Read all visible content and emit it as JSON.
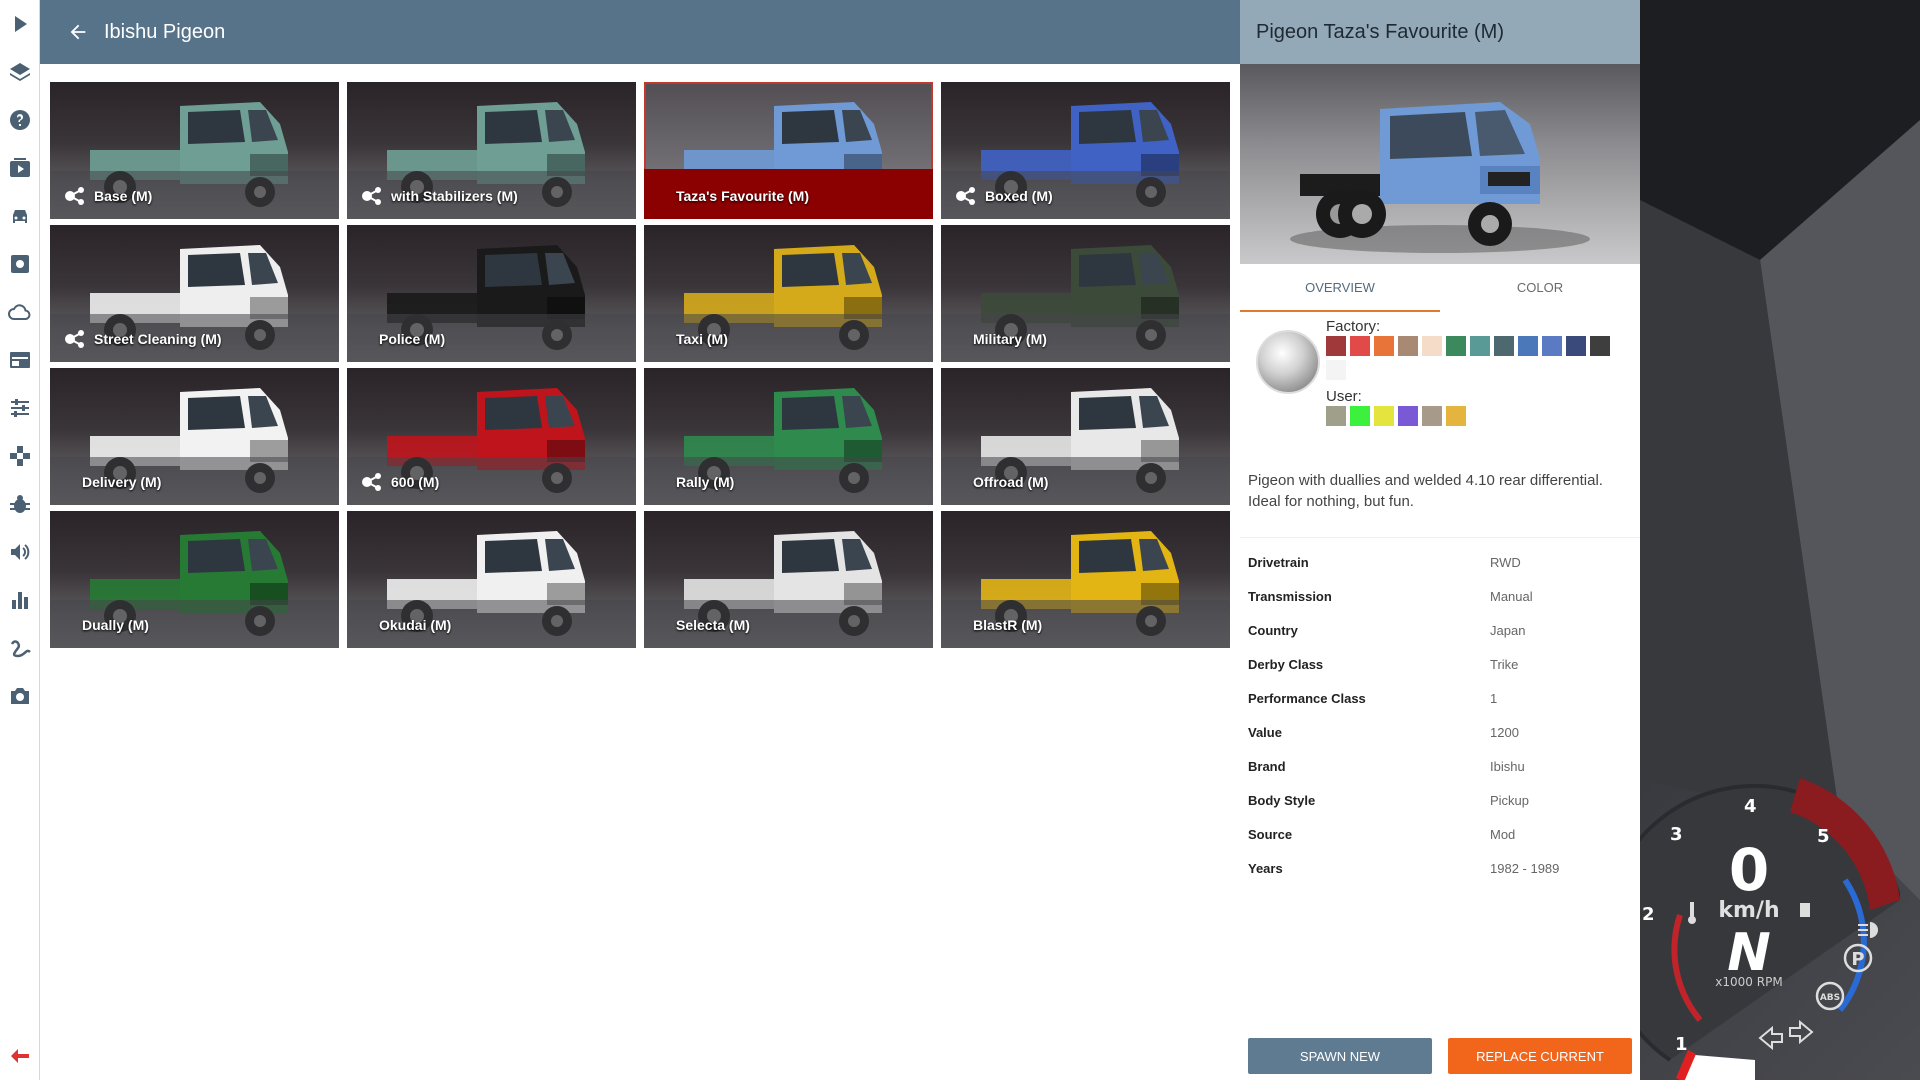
{
  "sidebar": {
    "icons": [
      "play-icon",
      "layers-icon",
      "help-icon",
      "media-icon",
      "car-icon",
      "settings-icon",
      "cloud-icon",
      "dashboard-icon",
      "sliders-icon",
      "gamepad-icon",
      "bug-icon",
      "audio-icon",
      "stats-icon",
      "path-icon",
      "camera-icon"
    ],
    "back_icon": "exit-arrow-icon"
  },
  "main": {
    "title": "Ibishu Pigeon",
    "tiles": [
      {
        "label": "Base (M)",
        "has_config_icon": true,
        "color": "#6e9e94"
      },
      {
        "label": "with Stabilizers (M)",
        "has_config_icon": true,
        "color": "#6e9e94"
      },
      {
        "label": "Taza's Favourite (M)",
        "has_config_icon": false,
        "color": "#6f9ad6",
        "selected": true
      },
      {
        "label": "Boxed (M)",
        "has_config_icon": true,
        "color": "#3f62c4"
      },
      {
        "label": "Street Cleaning (M)",
        "has_config_icon": true,
        "color": "#eeeeee"
      },
      {
        "label": "Police (M)",
        "has_config_icon": false,
        "color": "#1a1a1a"
      },
      {
        "label": "Taxi (M)",
        "has_config_icon": false,
        "color": "#d4aa1a"
      },
      {
        "label": "Military (M)",
        "has_config_icon": false,
        "color": "#3c4a3a"
      },
      {
        "label": "Delivery (M)",
        "has_config_icon": false,
        "color": "#f2f2f2"
      },
      {
        "label": "600 (M)",
        "has_config_icon": true,
        "color": "#c0141c"
      },
      {
        "label": "Rally (M)",
        "has_config_icon": false,
        "color": "#2f8a4e"
      },
      {
        "label": "Offroad (M)",
        "has_config_icon": false,
        "color": "#e8e8e8"
      },
      {
        "label": "Dually (M)",
        "has_config_icon": false,
        "color": "#267a34"
      },
      {
        "label": "Okudai (M)",
        "has_config_icon": false,
        "color": "#f0f0f0"
      },
      {
        "label": "Selecta (M)",
        "has_config_icon": false,
        "color": "#e4e4e4"
      },
      {
        "label": "BlastR (M)",
        "has_config_icon": false,
        "color": "#e2b414"
      }
    ]
  },
  "detail": {
    "title": "Pigeon Taza's Favourite (M)",
    "tabs": [
      "OVERVIEW",
      "COLOR"
    ],
    "factory_label": "Factory:",
    "user_label": "User:",
    "factory_colors": [
      "#a03a3a",
      "#e24a4a",
      "#e8743a",
      "#a88a74",
      "#f4dcc8",
      "#3a8a5e",
      "#5a9a96",
      "#4e6870",
      "#4a78b8",
      "#5a7ac4",
      "#3a4a7a",
      "#3e3e3e",
      "#f4f4f4"
    ],
    "user_colors": [
      "#a0a08a",
      "#3ef03e",
      "#e4e43e",
      "#7a5ad4",
      "#a89a8a",
      "#e4b43e"
    ],
    "description": "Pigeon with duallies and welded 4.10 rear differential. Ideal for nothing, but fun.",
    "specs": [
      {
        "key": "Drivetrain",
        "value": "RWD"
      },
      {
        "key": "Transmission",
        "value": "Manual"
      },
      {
        "key": "Country",
        "value": "Japan"
      },
      {
        "key": "Derby Class",
        "value": "Trike"
      },
      {
        "key": "Performance Class",
        "value": "1"
      },
      {
        "key": "Value",
        "value": "1200"
      },
      {
        "key": "Brand",
        "value": "Ibishu"
      },
      {
        "key": "Body Style",
        "value": "Pickup"
      },
      {
        "key": "Source",
        "value": "Mod"
      },
      {
        "key": "Years",
        "value": "1982 - 1989"
      }
    ],
    "spawn_label": "SPAWN NEW",
    "replace_label": "REPLACE CURRENT"
  },
  "hud": {
    "speed": "0",
    "speed_unit": "km/h",
    "gear": "N",
    "rpm_unit": "x1000 RPM",
    "rpm_ticks": [
      "1",
      "2",
      "3",
      "4",
      "5"
    ],
    "abs_label": "ABS",
    "park_label": "P"
  }
}
